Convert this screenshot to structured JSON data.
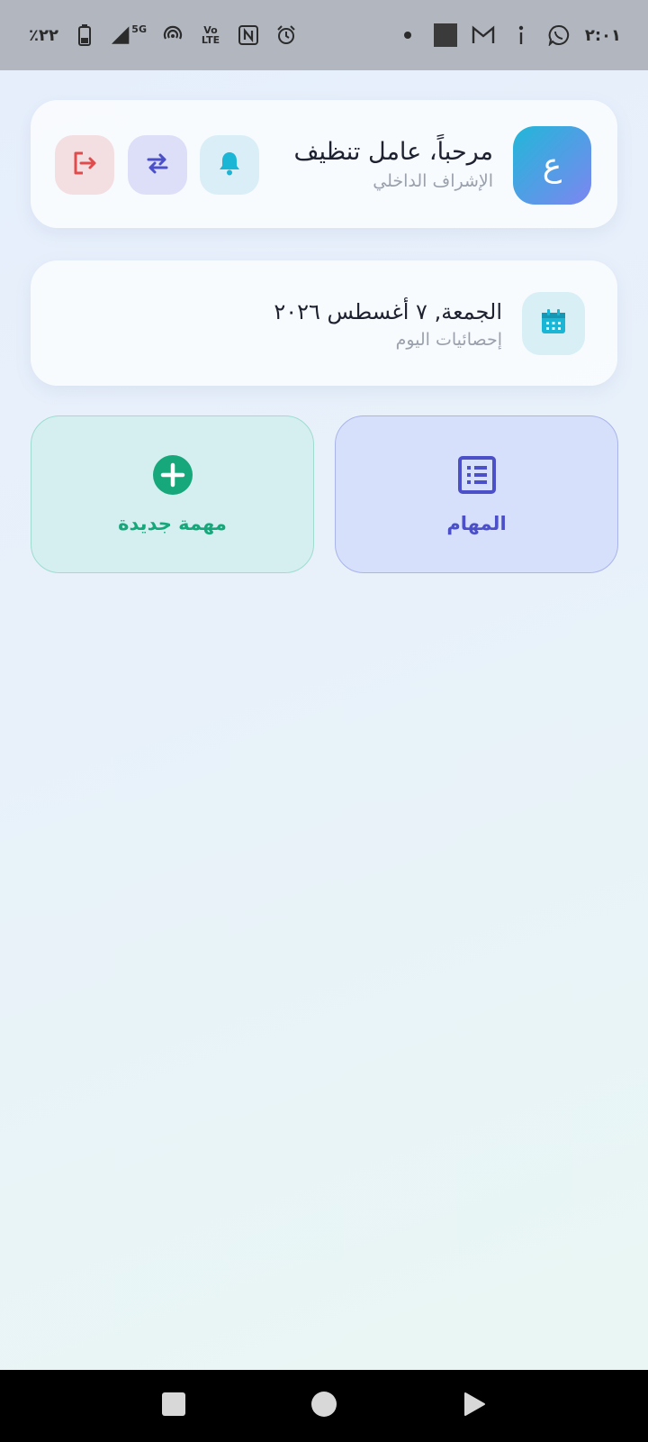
{
  "status_bar": {
    "time": "٢:٠١",
    "battery": "٪٢٢",
    "network": "5G",
    "volte": "Vo LTE"
  },
  "header": {
    "avatar_letter": "ع",
    "greeting": "مرحباً، عامل تنظيف",
    "role": "الإشراف الداخلي",
    "buttons": {
      "notifications_icon": "bell-icon",
      "switch_icon": "swap-icon",
      "logout_icon": "logout-icon"
    }
  },
  "date_card": {
    "date": "الجمعة, ٧ أغسطس ٢٠٢٦",
    "subtitle": "إحصائيات اليوم",
    "icon": "calendar-icon"
  },
  "tiles": {
    "tasks": {
      "label": "المهام",
      "icon": "list-icon"
    },
    "new_task": {
      "label": "مهمة جديدة",
      "icon": "plus-circle-icon"
    }
  },
  "colors": {
    "accent_teal": "#1bb5d6",
    "accent_indigo": "#4b50c9",
    "accent_green": "#16a77a",
    "danger": "#e14b4b"
  }
}
